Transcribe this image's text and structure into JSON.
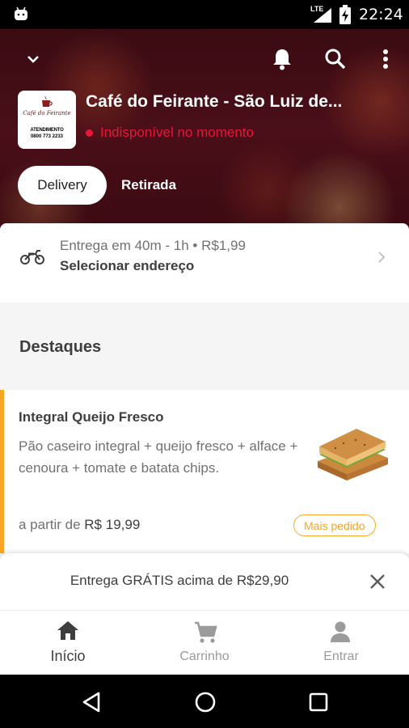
{
  "status_bar": {
    "network": "LTE",
    "time": "22:24"
  },
  "store": {
    "name": "Café do Feirante - São Luiz de...",
    "status": "Indisponível no momento",
    "logo": {
      "script_text": "Café do Feirante",
      "service_label": "ATENDIMENTO",
      "phone": "0800 773 2233"
    }
  },
  "tabs": [
    {
      "label": "Delivery",
      "active": true
    },
    {
      "label": "Retirada",
      "active": false
    }
  ],
  "delivery": {
    "info": "Entrega em 40m - 1h • R$1,99",
    "address_cta": "Selecionar endereço"
  },
  "highlights": {
    "title": "Destaques",
    "items": [
      {
        "name": "Integral Queijo Fresco",
        "description": "Pão caseiro integral + queijo fresco + alface + cenoura + tomate e batata chips.",
        "price_prefix": "a partir de",
        "price": "R$ 19,99",
        "badge": "Mais pedido"
      }
    ]
  },
  "promo": {
    "prefix": "Entrega",
    "highlight": "GRÁTIS",
    "middle": "acima de",
    "amount": "R$29,90"
  },
  "bottom_nav": [
    {
      "label": "Início",
      "icon": "home-icon",
      "active": true
    },
    {
      "label": "Carrinho",
      "icon": "cart-icon",
      "active": false
    },
    {
      "label": "Entrar",
      "icon": "person-icon",
      "active": false
    }
  ],
  "colors": {
    "accent": "#f7a723",
    "unavailable": "#e8173a",
    "hero_bg": "#3a0b12",
    "text_dark": "#3e3e3e",
    "text_muted": "#717171"
  }
}
